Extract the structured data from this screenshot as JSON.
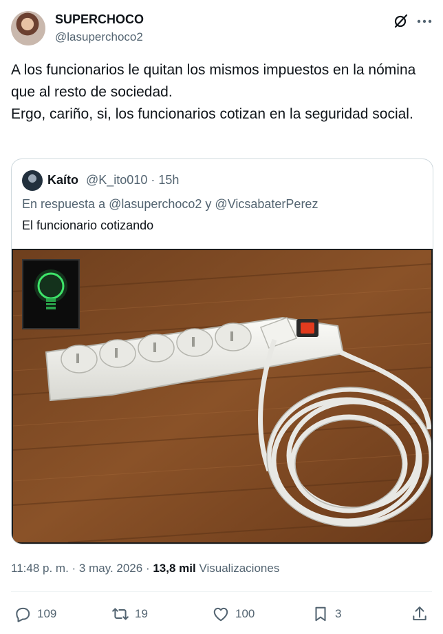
{
  "tweet": {
    "author_name": "SUPERCHOCO",
    "author_handle": "@lasuperchoco2",
    "text": "A los funcionarios le quitan los mismos impuestos en la nómina que al resto de sociedad.\nErgo, cariño, si, los funcionarios cotizan en la seguridad social.",
    "time": "11:48 p. m.",
    "date": "3 may. 2026",
    "views_count": "13,8 mil",
    "views_label": "Visualizaciones"
  },
  "quote": {
    "author_name": "Kaíto",
    "author_handle": "@K_ito010",
    "age": "15h",
    "reply_to": "En respuesta a @lasuperchoco2 y @VicsabaterPerez",
    "text": "El funcionario cotizando",
    "media_description_icon": "power-strip-image"
  },
  "actions": {
    "replies": "109",
    "retweets": "19",
    "likes": "100",
    "bookmarks": "3"
  },
  "icons": [
    "grok-icon",
    "more-icon",
    "reply-icon",
    "retweet-icon",
    "like-icon",
    "bookmark-icon",
    "share-icon",
    "lightbulb-icon"
  ],
  "colors": {
    "text": "#0f1419",
    "secondary": "#536471",
    "border": "#cfd9de"
  }
}
